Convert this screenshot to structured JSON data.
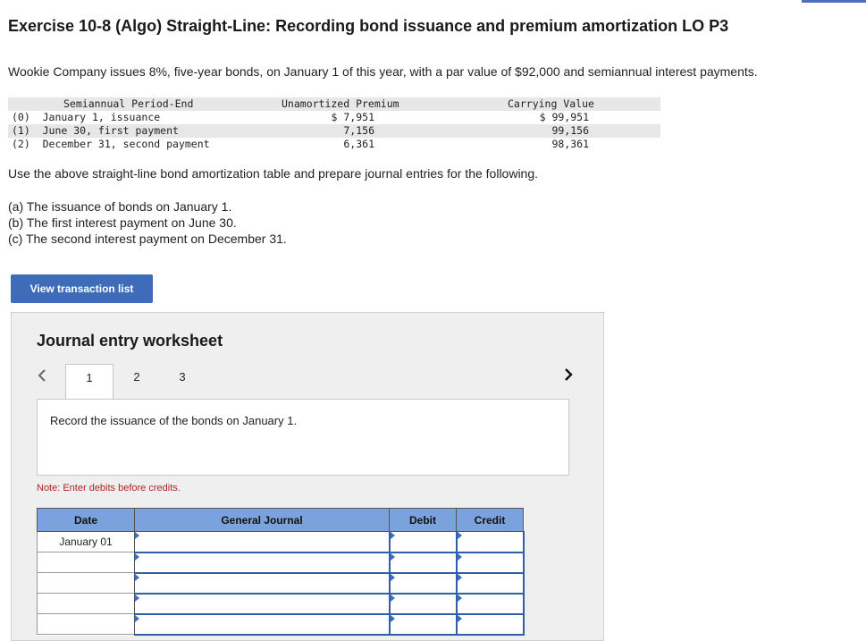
{
  "header": {
    "title": "Exercise 10-8 (Algo) Straight-Line: Recording bond issuance and premium amortization LO P3"
  },
  "intro_text": "Wookie Company issues 8%, five-year bonds, on January 1 of this year, with a par value of $92,000 and semiannual interest payments.",
  "amortization_table": {
    "headers": {
      "period": "Semiannual Period-End",
      "premium": "Unamortized Premium",
      "carrying": "Carrying Value"
    },
    "rows": [
      {
        "period": "(0)  January 1, issuance",
        "premium": "$ 7,951",
        "carrying": "$ 99,951"
      },
      {
        "period": "(1)  June 30, first payment",
        "premium": "7,156",
        "carrying": "99,156"
      },
      {
        "period": "(2)  December 31, second payment",
        "premium": "6,361",
        "carrying": "98,361"
      }
    ]
  },
  "instructions": "Use the above straight-line bond amortization table and prepare journal entries for the following.",
  "parts": [
    "(a) The issuance of bonds on January 1.",
    "(b) The first interest payment on June 30.",
    "(c) The second interest payment on December 31."
  ],
  "view_transaction_button": "View transaction list",
  "worksheet": {
    "title": "Journal entry worksheet",
    "tabs": [
      "1",
      "2",
      "3"
    ],
    "active_tab": "1",
    "prev_icon": "chevron-left-icon",
    "next_icon": "chevron-right-icon",
    "task_text": "Record the issuance of the bonds on January 1.",
    "note": "Note: Enter debits before credits.",
    "table": {
      "columns": [
        "Date",
        "General Journal",
        "Debit",
        "Credit"
      ],
      "first_date": "January 01"
    }
  },
  "colors": {
    "button_bg": "#3f6cb8",
    "table_header_bg": "#7aa2dd",
    "note_text": "#b22222",
    "input_border": "#2e5fa8"
  }
}
